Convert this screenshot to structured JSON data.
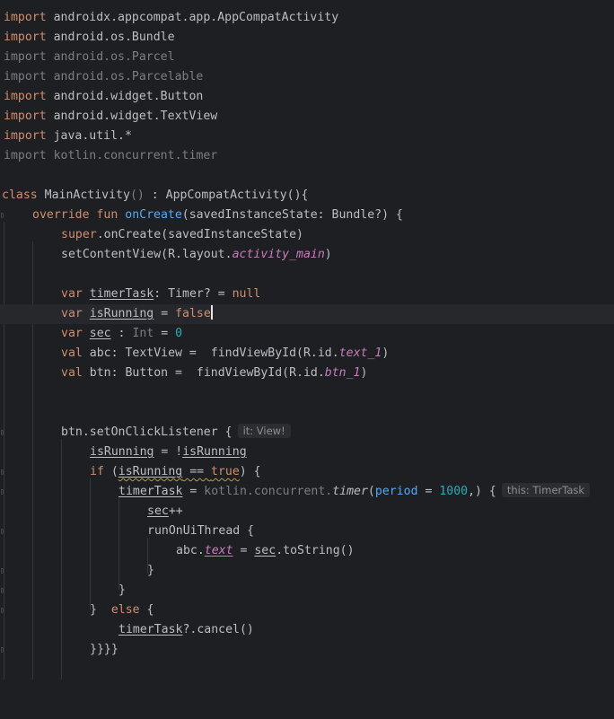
{
  "editor": {
    "imports": [
      {
        "keyword": "import",
        "path": "androidx.appcompat.app.AppCompatActivity",
        "used": true
      },
      {
        "keyword": "import",
        "path": "android.os.Bundle",
        "used": true
      },
      {
        "keyword": "import",
        "path": "android.os.Parcel",
        "used": false
      },
      {
        "keyword": "import",
        "path": "android.os.Parcelable",
        "used": false
      },
      {
        "keyword": "import",
        "path": "android.widget.Button",
        "used": true
      },
      {
        "keyword": "import",
        "path": "android.widget.TextView",
        "used": true
      },
      {
        "keyword": "import",
        "path": "java.util.*",
        "used": true
      },
      {
        "keyword": "import",
        "path": "kotlin.concurrent.timer",
        "used": false
      }
    ],
    "class_decl": {
      "kw_class": "class",
      "name": "MainActivity",
      "parens": "()",
      "sep": " : ",
      "super": "AppCompatActivity",
      "tail": "(){"
    },
    "on_create": {
      "kw_override": "override",
      "kw_fun": "fun",
      "name": "onCreate",
      "params": "(savedInstanceState: Bundle?) {"
    },
    "super_call": {
      "kw_super": "super",
      "dot": ".",
      "fn": "onCreate",
      "args": "(savedInstanceState)"
    },
    "set_content": {
      "fn": "setContentView",
      "open": "(R.layout.",
      "prop": "activity_main",
      "close": ")"
    },
    "var_timer": {
      "kw": "var",
      "name": "timerTask",
      "type": ": Timer? = ",
      "value": "null"
    },
    "var_running": {
      "kw": "var",
      "name": "isRunning",
      "eq": " = ",
      "value": "false"
    },
    "var_sec": {
      "kw": "var",
      "name": "sec",
      "type_sep": " : ",
      "type": "Int",
      "eq": " = ",
      "value": "0"
    },
    "val_abc": {
      "kw": "val",
      "decl": "abc: TextView =  ",
      "fn": "findViewById",
      "open": "(R.id.",
      "prop": "text_1",
      "close": ")"
    },
    "val_btn": {
      "kw": "val",
      "decl": "btn: Button =  ",
      "fn": "findViewById",
      "open": "(R.id.",
      "prop": "btn_1",
      "close": ")"
    },
    "listener": {
      "fn": "btn.setOnClickListener",
      "open": " {",
      "hint": "it: View!"
    },
    "toggle": {
      "name": "isRunning",
      "eq": " = !",
      "name2": "isRunning"
    },
    "if_stmt": {
      "kw_if": "if",
      "open": " (",
      "cond_name": "isRunning",
      "cond_op": " == ",
      "cond_val": "true",
      "close": ") {"
    },
    "timer_assign": {
      "name": "timerTask",
      "eq": " = ",
      "pkg": "kotlin.concurrent.",
      "fn": "timer",
      "open": "(",
      "param": "period",
      "param_eq": " = ",
      "param_val": "1000",
      "close": ",) {",
      "hint": "this: TimerTask"
    },
    "sec_inc": {
      "name": "sec",
      "op": "++"
    },
    "run_ui": {
      "fn": "runOnUiThread",
      "open": " {"
    },
    "set_text": {
      "obj": "abc.",
      "prop": "text",
      "eq": " = ",
      "name": "sec",
      "call": ".toString()"
    },
    "brace_close": "}",
    "else_stmt": {
      "pre": "}  ",
      "kw_else": "else",
      "open": " {"
    },
    "cancel_call": {
      "name": "timerTask",
      "call": "?.cancel()"
    },
    "end_braces": "}}}}"
  },
  "colors": {
    "background": "#1e1f22",
    "default_text": "#bcbec4",
    "keyword": "#cf8e6d",
    "function": "#56a8f5",
    "number": "#2aacb8",
    "property": "#c77dbb",
    "unused_import": "#7a7e85"
  }
}
